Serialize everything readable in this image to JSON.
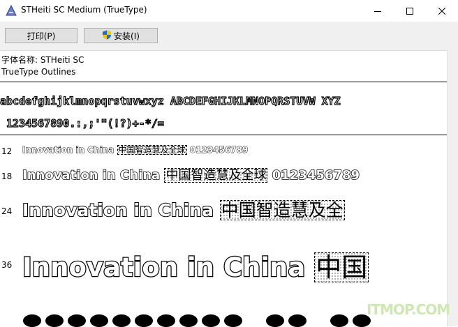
{
  "window": {
    "title": "STHeiti SC Medium (TrueType)",
    "icon": "font-file-icon",
    "controls": {
      "minimize": "minimize-icon",
      "maximize": "maximize-icon",
      "close": "close-icon"
    }
  },
  "toolbar": {
    "print_label": "打印(P)",
    "install_label": "安装(I)",
    "install_icon": "shield-icon"
  },
  "font_info": {
    "name_line": "字体名称: STHeiti SC",
    "type_line": "TrueType Outlines"
  },
  "charset": {
    "line1": "abcdefghijklmnopqrstuvwxyz ABCDEFGHIJKLMNOPQRSTUVW XYZ",
    "line2": " 1234567890.:,;'\"(!?)+-*/= "
  },
  "samples": [
    {
      "size": "12",
      "latin": "Innovation in China",
      "cjk": "中国智造慧及全球",
      "digits": "0123456789"
    },
    {
      "size": "18",
      "latin": "Innovation in China",
      "cjk": "中国智造慧及全球",
      "digits": "0123456789"
    },
    {
      "size": "24",
      "latin": "Innovation in China",
      "cjk": "中国智造慧及全"
    },
    {
      "size": "36",
      "latin": "Innovation in China",
      "cjk": "中国"
    }
  ],
  "watermark": "ITMOP.COM",
  "colors": {
    "toolbar_bg": "#f0f0f0",
    "button_bg": "#e1e1e1",
    "button_border": "#adadad",
    "shield_blue": "#1f6fd0",
    "shield_yellow": "#f2c811"
  }
}
